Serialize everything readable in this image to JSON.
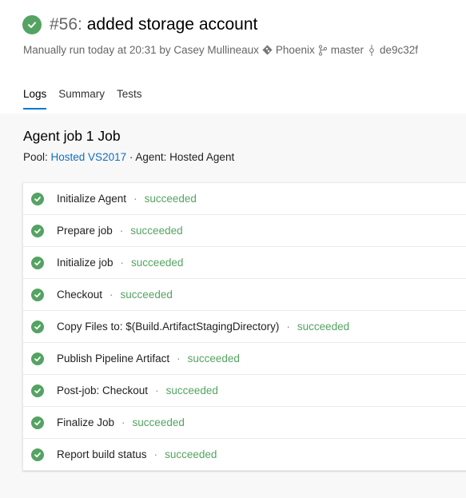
{
  "header": {
    "run_number": "#56:",
    "title": " added storage account",
    "subtitle": {
      "trigger_text": "Manually run today at 20:31 by Casey Mullineaux",
      "repo": "Phoenix",
      "branch": "master",
      "commit": "de9c32f"
    }
  },
  "tabs": [
    {
      "label": "Logs",
      "active": true
    },
    {
      "label": "Summary",
      "active": false
    },
    {
      "label": "Tests",
      "active": false
    }
  ],
  "job": {
    "title": "Agent job 1 Job",
    "pool_label": "Pool: ",
    "pool_link": "Hosted VS2017",
    "agent_text": " · Agent: Hosted Agent"
  },
  "steps": [
    {
      "name": "Initialize Agent",
      "status": "succeeded"
    },
    {
      "name": "Prepare job",
      "status": "succeeded"
    },
    {
      "name": "Initialize job",
      "status": "succeeded"
    },
    {
      "name": "Checkout",
      "status": "succeeded"
    },
    {
      "name": "Copy Files to: $(Build.ArtifactStagingDirectory)",
      "status": "succeeded"
    },
    {
      "name": "Publish Pipeline Artifact",
      "status": "succeeded"
    },
    {
      "name": "Post-job: Checkout",
      "status": "succeeded"
    },
    {
      "name": "Finalize Job",
      "status": "succeeded"
    },
    {
      "name": "Report build status",
      "status": "succeeded"
    }
  ],
  "separator": "·",
  "colors": {
    "success": "#55a362",
    "accent": "#0078d4",
    "link": "#106ebe"
  }
}
